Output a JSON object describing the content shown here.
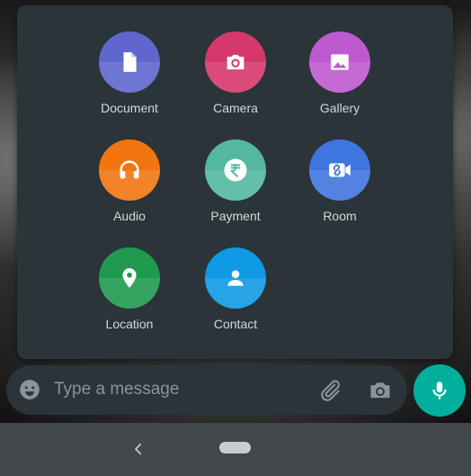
{
  "attach_menu": {
    "items": [
      {
        "label": "Document",
        "icon": "document-icon",
        "color": "#5f66cd"
      },
      {
        "label": "Camera",
        "icon": "camera-icon",
        "color": "#d5386a"
      },
      {
        "label": "Gallery",
        "icon": "gallery-icon",
        "color": "#bf59cf"
      },
      {
        "label": "Audio",
        "icon": "headphones-icon",
        "color": "#f2750f"
      },
      {
        "label": "Payment",
        "icon": "rupee-icon",
        "color": "#53b89f"
      },
      {
        "label": "Room",
        "icon": "room-video-icon",
        "color": "#3f75de"
      },
      {
        "label": "Location",
        "icon": "location-pin-icon",
        "color": "#1f9a4f"
      },
      {
        "label": "Contact",
        "icon": "contact-icon",
        "color": "#0e9ae4"
      }
    ]
  },
  "composer": {
    "placeholder": "Type a message",
    "emoji_icon": "emoji-icon",
    "attach_icon": "paperclip-icon",
    "camera_icon": "camera-icon",
    "send_icon": "microphone-icon",
    "send_color": "#00af9c"
  },
  "nav": {
    "back_icon": "back-chevron-icon",
    "home_icon": "home-pill-icon"
  }
}
